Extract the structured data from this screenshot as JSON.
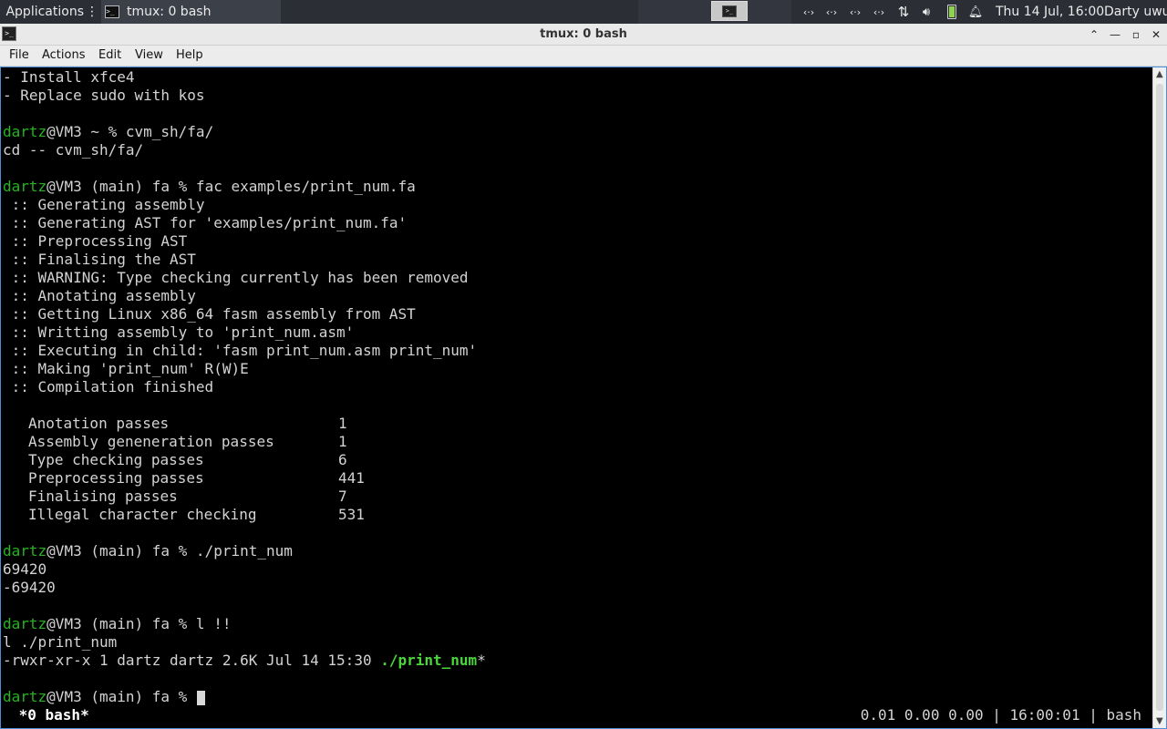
{
  "panel": {
    "apps_label": "Applications",
    "task_label": "tmux: 0 bash",
    "tray_icons": [
      "network-icon",
      "network-icon",
      "network-icon",
      "network-icon",
      "transfer-icon",
      "volume-icon",
      "battery-icon",
      "notification-icon"
    ],
    "clock": "Thu 14 Jul, 16:00",
    "user": "Darty uwu"
  },
  "window": {
    "title": "tmux: 0 bash",
    "menu": [
      "File",
      "Actions",
      "Edit",
      "View",
      "Help"
    ]
  },
  "terminal": {
    "lines": [
      "- Install xfce4",
      "- Replace sudo with kos",
      "",
      "@VM3 ~ % cvm_sh/fa/",
      "cd -- cvm_sh/fa/",
      "",
      "@VM3 (main) fa % fac examples/print_num.fa",
      " :: Generating assembly",
      " :: Generating AST for 'examples/print_num.fa'",
      " :: Preprocessing AST",
      " :: Finalising the AST",
      " :: WARNING: Type checking currently has been removed",
      " :: Anotating assembly",
      " :: Getting Linux x86_64 fasm assembly from AST",
      " :: Writting assembly to 'print_num.asm'",
      " :: Executing in child: 'fasm print_num.asm print_num'",
      " :: Making 'print_num' R(W)E",
      " :: Compilation finished",
      "",
      "@VM3 (main) fa % ./print_num",
      "69420",
      "-69420",
      "",
      "@VM3 (main) fa % l !!",
      "l ./print_num",
      "-rwxr-xr-x 1 dartz dartz 2.6K Jul 14 15:30 ",
      "*",
      "",
      "@VM3 (main) fa % "
    ],
    "prompt_user": "dartz",
    "exec_name": "./print_num",
    "stats": [
      {
        "label": "Anotation passes",
        "value": "1"
      },
      {
        "label": "Assembly geneneration passes",
        "value": "1"
      },
      {
        "label": "Type checking passes",
        "value": "6"
      },
      {
        "label": "Preprocessing passes",
        "value": "441"
      },
      {
        "label": "Finalising passes",
        "value": "7"
      },
      {
        "label": "Illegal character checking",
        "value": "531"
      }
    ],
    "status_left": " *0 bash*",
    "status_right": "0.01 0.00 0.00 | 16:00:01 | bash"
  },
  "colors": {
    "prompt_user": "#22b51e",
    "executable": "#4bd63c",
    "panel_bg": "#2b2e35",
    "frame_accent": "#4d8fd6"
  }
}
